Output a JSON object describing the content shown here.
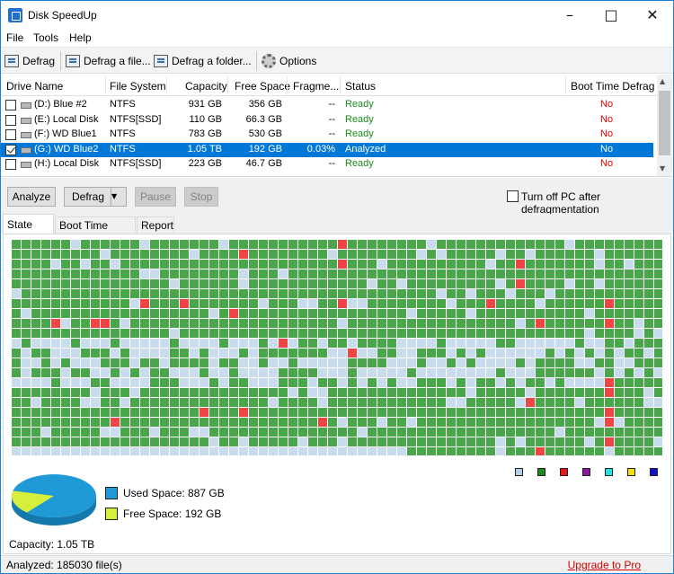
{
  "window": {
    "title": "Disk SpeedUp"
  },
  "menu": [
    "File",
    "Tools",
    "Help"
  ],
  "toolbar": {
    "defrag": "Defrag",
    "defrag_file": "Defrag a file...",
    "defrag_folder": "Defrag a folder...",
    "options": "Options"
  },
  "columns": [
    "Drive Name",
    "File System",
    "Capacity",
    "Free Space",
    "Fragme...",
    "Status",
    "Boot Time Defrag"
  ],
  "drives": [
    {
      "checked": false,
      "selected": false,
      "name": "(D:) Blue #2",
      "fs": "NTFS",
      "capacity": "931 GB",
      "free": "356 GB",
      "frag": "--",
      "status": "Ready",
      "boot": "No",
      "boot_color": "#e00000"
    },
    {
      "checked": false,
      "selected": false,
      "name": "(E:) Local Disk",
      "fs": "NTFS[SSD]",
      "capacity": "110 GB",
      "free": "66.3 GB",
      "frag": "--",
      "status": "Ready",
      "boot": "No",
      "boot_color": "#e00000"
    },
    {
      "checked": false,
      "selected": false,
      "name": "(F:) WD Blue1",
      "fs": "NTFS",
      "capacity": "783 GB",
      "free": "530 GB",
      "frag": "--",
      "status": "Ready",
      "boot": "No",
      "boot_color": "#e00000"
    },
    {
      "checked": true,
      "selected": true,
      "name": "(G:) WD Blue2",
      "fs": "NTFS",
      "capacity": "1.05 TB",
      "free": "192 GB",
      "frag": "0.03%",
      "status": "Analyzed",
      "boot": "No",
      "boot_color": "#ffffff"
    },
    {
      "checked": false,
      "selected": false,
      "name": "(H:) Local Disk",
      "fs": "NTFS[SSD]",
      "capacity": "223 GB",
      "free": "46.7 GB",
      "frag": "--",
      "status": "Ready",
      "boot": "No",
      "boot_color": "#e00000"
    }
  ],
  "actions": {
    "analyze": "Analyze",
    "defrag": "Defrag",
    "pause": "Pause",
    "stop": "Stop",
    "turn_off_label": "Turn off PC after defragmentation",
    "turn_off_checked": false
  },
  "tabs": [
    {
      "label": "State (G:)",
      "active": true
    },
    {
      "label": "Boot Time Defrag",
      "active": false
    },
    {
      "label": "Report",
      "active": false
    }
  ],
  "cluster_map": {
    "colors": {
      "used": "#4aa64a",
      "free": "#c9dcee",
      "fragmented": "#ef4545"
    },
    "columns": 72,
    "rows": 29
  },
  "legend_colors": [
    "#aecde9",
    "#1a8a1a",
    "#e81818",
    "#8b1a9a",
    "#22e3e3",
    "#f5e000",
    "#1010d0"
  ],
  "disk": {
    "used_label": "Used Space: 887 GB",
    "free_label": "Free Space: 192 GB",
    "capacity_label": "Capacity: 1.05 TB",
    "used_color": "#1f9ad6",
    "free_color": "#d6ef3a",
    "used_fraction": 0.822
  },
  "status": {
    "analyzed": "Analyzed: 185030 file(s)",
    "upgrade": "Upgrade to Pro"
  }
}
